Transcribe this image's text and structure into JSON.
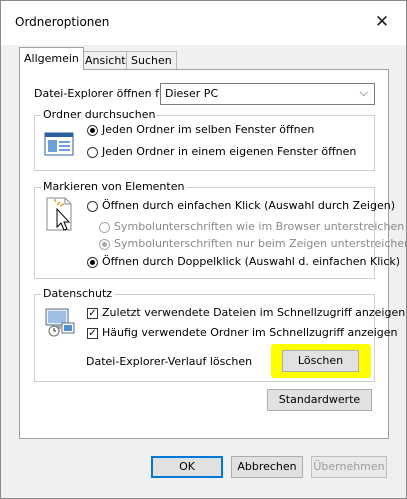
{
  "window": {
    "title": "Ordneroptionen"
  },
  "tabs": [
    {
      "label": "Allgemein"
    },
    {
      "label": "Ansicht"
    },
    {
      "label": "Suchen"
    }
  ],
  "explorer_open": {
    "label": "Datei-Explorer öffnen für:",
    "value": "Dieser PC"
  },
  "browse_group": {
    "legend": "Ordner durchsuchen",
    "options": [
      {
        "label": "Jeden Ordner im selben Fenster öffnen",
        "selected": true
      },
      {
        "label": "Jeden Ordner in einem eigenen Fenster öffnen",
        "selected": false
      }
    ]
  },
  "click_group": {
    "legend": "Markieren von Elementen",
    "single_click": {
      "label": "Öffnen durch einfachen Klick (Auswahl durch Zeigen)"
    },
    "underline_browser": {
      "label": "Symbolunterschriften wie im Browser unterstreichen"
    },
    "underline_hover": {
      "label": "Symbolunterschriften nur beim Zeigen unterstreichen"
    },
    "double_click": {
      "label": "Öffnen durch Doppelklick (Auswahl d. einfachen Klick)"
    }
  },
  "privacy_group": {
    "legend": "Datenschutz",
    "recent_files": {
      "label": "Zuletzt verwendete Dateien im Schnellzugriff anzeigen"
    },
    "frequent_folders": {
      "label": "Häufig verwendete Ordner im Schnellzugriff anzeigen"
    },
    "clear_label": "Datei-Explorer-Verlauf löschen",
    "clear_button": "Löschen"
  },
  "buttons": {
    "defaults": "Standardwerte",
    "ok": "OK",
    "cancel": "Abbrechen",
    "apply": "Übernehmen"
  },
  "colors": {
    "highlight": "#ffff00",
    "accent": "#0078d7"
  },
  "icons": {
    "close": "close-icon",
    "dropdown": "chevron-down-icon",
    "browse": "folder-window-icon",
    "click": "pointer-click-icon",
    "privacy": "privacy-computer-icon"
  }
}
